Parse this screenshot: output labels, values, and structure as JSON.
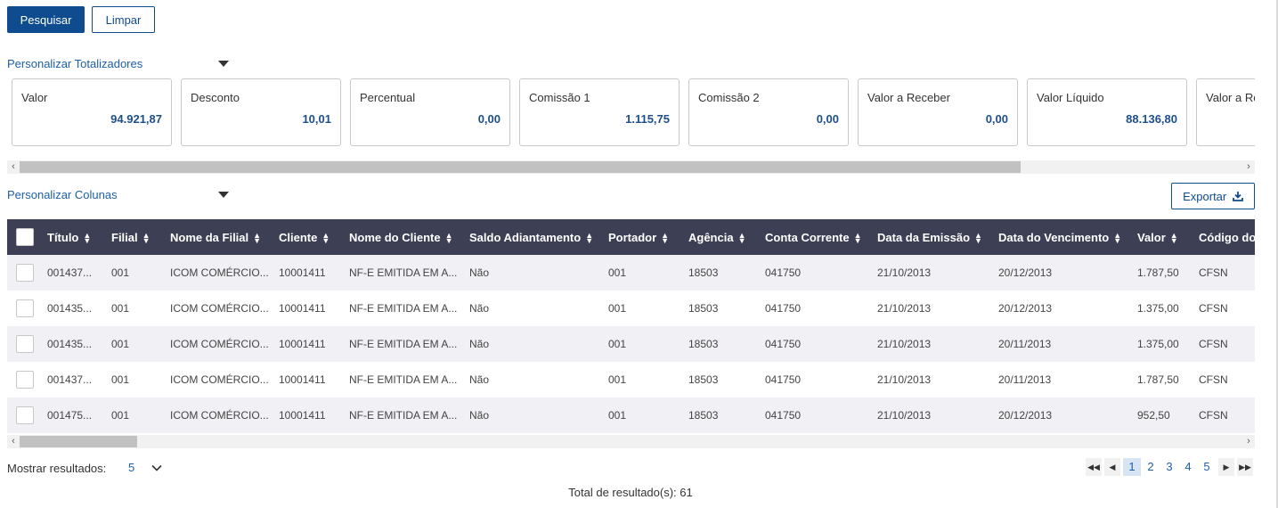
{
  "actions": {
    "search_label": "Pesquisar",
    "clear_label": "Limpar"
  },
  "totals": {
    "toggle_label": "Personalizar Totalizadores",
    "cards": [
      {
        "label": "Valor",
        "value": "94.921,87"
      },
      {
        "label": "Desconto",
        "value": "10,01"
      },
      {
        "label": "Percentual",
        "value": "0,00"
      },
      {
        "label": "Comissão 1",
        "value": "1.115,75"
      },
      {
        "label": "Comissão 2",
        "value": "0,00"
      },
      {
        "label": "Valor a Receber",
        "value": "0,00"
      },
      {
        "label": "Valor Líquido",
        "value": "88.136,80"
      },
      {
        "label": "Valor a Re",
        "value": ""
      }
    ]
  },
  "columns": {
    "toggle_label": "Personalizar Colunas",
    "export_label": "Exportar",
    "headers": [
      "Título",
      "Filial",
      "Nome da Filial",
      "Cliente",
      "Nome do Cliente",
      "Saldo Adiantamento",
      "Portador",
      "Agência",
      "Conta Corrente",
      "Data da Emissão",
      "Data do Vencimento",
      "Valor",
      "Código do"
    ]
  },
  "rows": [
    [
      "001437...",
      "001",
      "ICOM COMÉRCIO...",
      "10001411",
      "NF-E EMITIDA EM A...",
      "Não",
      "001",
      "18503",
      "041750",
      "21/10/2013",
      "20/12/2013",
      "1.787,50",
      "CFSN"
    ],
    [
      "001435...",
      "001",
      "ICOM COMÉRCIO...",
      "10001411",
      "NF-E EMITIDA EM A...",
      "Não",
      "001",
      "18503",
      "041750",
      "21/10/2013",
      "20/12/2013",
      "1.375,00",
      "CFSN"
    ],
    [
      "001435...",
      "001",
      "ICOM COMÉRCIO...",
      "10001411",
      "NF-E EMITIDA EM A...",
      "Não",
      "001",
      "18503",
      "041750",
      "21/10/2013",
      "20/11/2013",
      "1.375,00",
      "CFSN"
    ],
    [
      "001437...",
      "001",
      "ICOM COMÉRCIO...",
      "10001411",
      "NF-E EMITIDA EM A...",
      "Não",
      "001",
      "18503",
      "041750",
      "21/10/2013",
      "20/11/2013",
      "1.787,50",
      "CFSN"
    ],
    [
      "001475...",
      "001",
      "ICOM COMÉRCIO...",
      "10001411",
      "NF-E EMITIDA EM A...",
      "Não",
      "001",
      "18503",
      "041750",
      "21/10/2013",
      "20/12/2013",
      "952,50",
      "CFSN"
    ]
  ],
  "footer": {
    "show_label": "Mostrar resultados:",
    "page_size": "5",
    "pages": [
      "1",
      "2",
      "3",
      "4",
      "5"
    ],
    "current_page": "1",
    "total_label": "Total de resultado(s): 61"
  },
  "colors": {
    "primary": "#0e4b8f",
    "header_bg": "#3d3f55",
    "value_text": "#1d4f8c"
  },
  "icons": {
    "export": "download-icon",
    "sort": "sort-icon",
    "dropdown": "caret-down-icon"
  }
}
